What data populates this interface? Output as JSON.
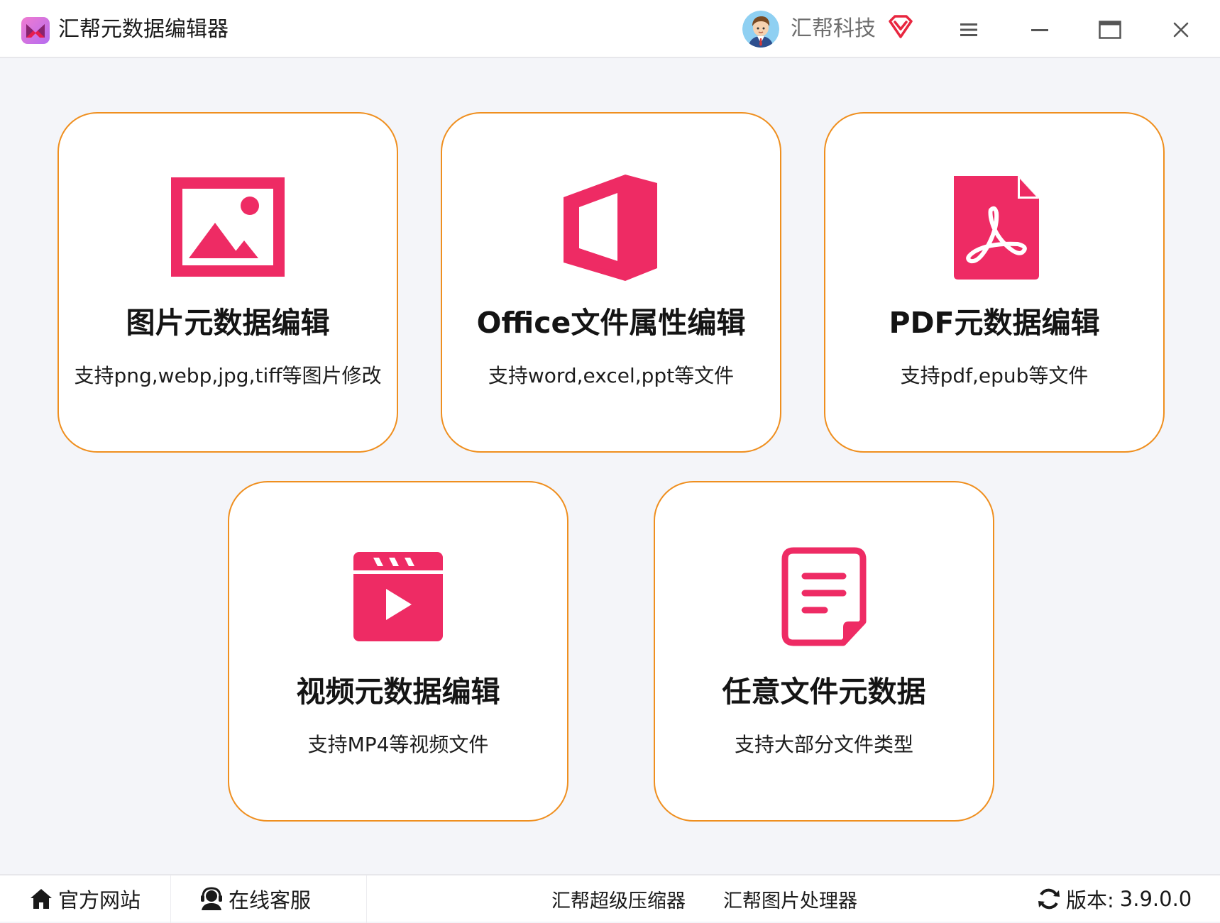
{
  "window": {
    "title": "汇帮元数据编辑器",
    "user_name": "汇帮科技",
    "icons": {
      "app_logo": "app-logo-icon",
      "avatar": "user-avatar",
      "vip": "vip-diamond-icon",
      "menu": "hamburger-menu-icon",
      "minimize": "minimize-icon",
      "maximize": "maximize-icon",
      "close": "close-icon"
    }
  },
  "colors": {
    "accent": "#ee2b64",
    "card_border": "#ef8f1f",
    "background": "#f4f5f9"
  },
  "cards": [
    {
      "title": "图片元数据编辑",
      "desc": "支持png,webp,jpg,tiff等图片修改",
      "icon": "image-icon"
    },
    {
      "title": "Office文件属性编辑",
      "desc": "支持word,excel,ppt等文件",
      "icon": "office-icon"
    },
    {
      "title": "PDF元数据编辑",
      "desc": "支持pdf,epub等文件",
      "icon": "pdf-icon"
    },
    {
      "title": "视频元数据编辑",
      "desc": "支持MP4等视频文件",
      "icon": "video-icon"
    },
    {
      "title": "任意文件元数据",
      "desc": "支持大部分文件类型",
      "icon": "document-icon"
    }
  ],
  "footer": {
    "website": "官方网站",
    "support": "在线客服",
    "compressor": "汇帮超级压缩器",
    "image_processor": "汇帮图片处理器",
    "version_label": "版本:",
    "version": "3.9.0.0"
  }
}
